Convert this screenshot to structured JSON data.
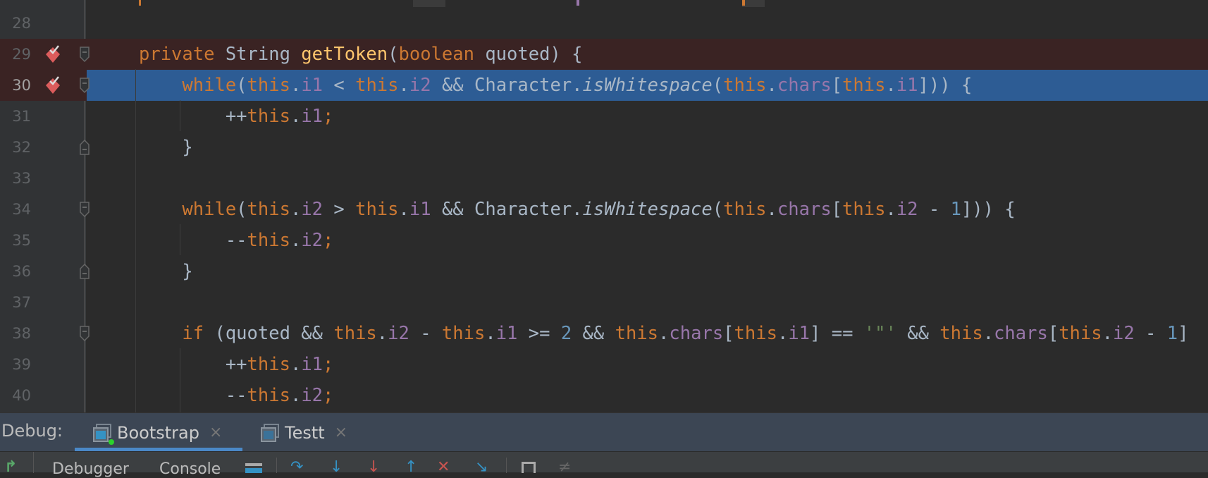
{
  "editor": {
    "lines": [
      {
        "num": "28",
        "tokens": []
      },
      {
        "num": "29",
        "breakpoint": true,
        "fold": "start",
        "tokens": [
          [
            "k",
            "private "
          ],
          [
            "",
            "String "
          ],
          [
            "m",
            "getToken"
          ],
          [
            "",
            "("
          ],
          [
            "k",
            "boolean "
          ],
          [
            "",
            "quoted) {"
          ]
        ]
      },
      {
        "num": "30",
        "breakpoint": true,
        "exec": true,
        "fold": "start",
        "tokens": [
          [
            "k",
            "    while"
          ],
          [
            "",
            "("
          ],
          [
            "k",
            "this"
          ],
          [
            "",
            "."
          ],
          [
            "f",
            "i1"
          ],
          [
            "",
            " < "
          ],
          [
            "k",
            "this"
          ],
          [
            "",
            "."
          ],
          [
            "f",
            "i2"
          ],
          [
            "",
            " && Character."
          ],
          [
            "i",
            "isWhitespace"
          ],
          [
            "",
            "("
          ],
          [
            "k",
            "this"
          ],
          [
            "",
            "."
          ],
          [
            "f",
            "chars"
          ],
          [
            "",
            "["
          ],
          [
            "k",
            "this"
          ],
          [
            "",
            "."
          ],
          [
            "f",
            "i1"
          ],
          [
            "",
            "])) {"
          ]
        ]
      },
      {
        "num": "31",
        "tokens": [
          [
            "",
            "        ++"
          ],
          [
            "k",
            "this"
          ],
          [
            "",
            "."
          ],
          [
            "f",
            "i1"
          ],
          [
            "k",
            ";"
          ]
        ]
      },
      {
        "num": "32",
        "fold": "end",
        "tokens": [
          [
            "",
            "    }"
          ]
        ]
      },
      {
        "num": "33",
        "tokens": []
      },
      {
        "num": "34",
        "fold": "start",
        "tokens": [
          [
            "k",
            "    while"
          ],
          [
            "",
            "("
          ],
          [
            "k",
            "this"
          ],
          [
            "",
            "."
          ],
          [
            "f",
            "i2"
          ],
          [
            "",
            " > "
          ],
          [
            "k",
            "this"
          ],
          [
            "",
            "."
          ],
          [
            "f",
            "i1"
          ],
          [
            "",
            " && Character."
          ],
          [
            "i",
            "isWhitespace"
          ],
          [
            "",
            "("
          ],
          [
            "k",
            "this"
          ],
          [
            "",
            "."
          ],
          [
            "f",
            "chars"
          ],
          [
            "",
            "["
          ],
          [
            "k",
            "this"
          ],
          [
            "",
            "."
          ],
          [
            "f",
            "i2"
          ],
          [
            "",
            " - "
          ],
          [
            "n",
            "1"
          ],
          [
            "",
            "])) {"
          ]
        ]
      },
      {
        "num": "35",
        "tokens": [
          [
            "",
            "        --"
          ],
          [
            "k",
            "this"
          ],
          [
            "",
            "."
          ],
          [
            "f",
            "i2"
          ],
          [
            "k",
            ";"
          ]
        ]
      },
      {
        "num": "36",
        "fold": "end",
        "tokens": [
          [
            "",
            "    }"
          ]
        ]
      },
      {
        "num": "37",
        "tokens": []
      },
      {
        "num": "38",
        "fold": "start",
        "tokens": [
          [
            "k",
            "    if "
          ],
          [
            "",
            "(quoted && "
          ],
          [
            "k",
            "this"
          ],
          [
            "",
            "."
          ],
          [
            "f",
            "i2"
          ],
          [
            "",
            " - "
          ],
          [
            "k",
            "this"
          ],
          [
            "",
            "."
          ],
          [
            "f",
            "i1"
          ],
          [
            "",
            " >= "
          ],
          [
            "n",
            "2"
          ],
          [
            "",
            " && "
          ],
          [
            "k",
            "this"
          ],
          [
            "",
            "."
          ],
          [
            "f",
            "chars"
          ],
          [
            "",
            "["
          ],
          [
            "k",
            "this"
          ],
          [
            "",
            "."
          ],
          [
            "f",
            "i1"
          ],
          [
            "",
            "] == "
          ],
          [
            "s",
            "'\"'"
          ],
          [
            "",
            " && "
          ],
          [
            "k",
            "this"
          ],
          [
            "",
            "."
          ],
          [
            "f",
            "chars"
          ],
          [
            "",
            "["
          ],
          [
            "k",
            "this"
          ],
          [
            "",
            "."
          ],
          [
            "f",
            "i2"
          ],
          [
            "",
            " - "
          ],
          [
            "n",
            "1"
          ],
          [
            "",
            "]"
          ]
        ]
      },
      {
        "num": "39",
        "tokens": [
          [
            "",
            "        ++"
          ],
          [
            "k",
            "this"
          ],
          [
            "",
            "."
          ],
          [
            "f",
            "i1"
          ],
          [
            "k",
            ";"
          ]
        ]
      },
      {
        "num": "40",
        "tokens": [
          [
            "",
            "        --"
          ],
          [
            "k",
            "this"
          ],
          [
            "",
            "."
          ],
          [
            "f",
            "i2"
          ],
          [
            "k",
            ";"
          ]
        ]
      }
    ]
  },
  "debug": {
    "label": "Debug:",
    "tabs": [
      {
        "label": "Bootstrap",
        "active": true,
        "running": true
      },
      {
        "label": "Testt",
        "active": false
      }
    ],
    "close_glyph": "×"
  },
  "toolbar": {
    "debugger_label": "Debugger",
    "console_label": "Console",
    "icons": [
      "rerun-icon",
      "layout-icon",
      "show-execution-point-icon",
      "step-over-icon",
      "step-into-icon",
      "force-step-into-icon",
      "step-out-icon",
      "drop-frame-icon",
      "run-to-cursor-icon",
      "evaluate-expression-icon",
      "trace-icon"
    ]
  },
  "colors": {
    "keyword": "#cc7832",
    "field": "#9876aa",
    "number": "#6897bb",
    "method": "#ffc66d",
    "string": "#6a8759",
    "exec_line": "#2d5c94",
    "breakpoint_line": "#3a2323",
    "tab_underline": "#4a88c7"
  }
}
